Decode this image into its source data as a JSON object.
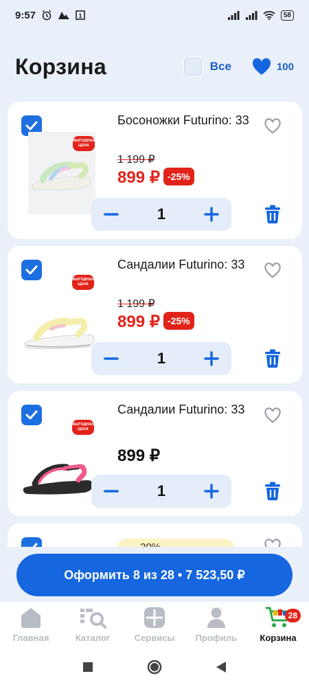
{
  "status_bar": {
    "time": "9:57",
    "battery": "58"
  },
  "header": {
    "title": "Корзина",
    "select_all_label": "Все",
    "favorites_count": "100"
  },
  "cart_items": [
    {
      "title": "Босоножки Futurino: 33",
      "old_price": "1 199 ₽",
      "price": "899 ₽",
      "discount": "-25%",
      "quantity": "1",
      "promo_badge": "ВЫГОДНАЯ ЦЕНА",
      "checked": true
    },
    {
      "title": "Сандалии Futurino: 33",
      "old_price": "1 199 ₽",
      "price": "899 ₽",
      "discount": "-25%",
      "quantity": "1",
      "promo_badge": "ВЫГОДНАЯ ЦЕНА",
      "checked": true
    },
    {
      "title": "Сандалии Futurino: 33",
      "price": "899 ₽",
      "quantity": "1",
      "promo_badge": "ВЫГОДНАЯ ЦЕНА",
      "checked": true
    },
    {
      "label_partial": "-20%"
    }
  ],
  "checkout": {
    "label": "Оформить 8 из 28 • 7 523,50 ₽"
  },
  "tabbar": {
    "items": [
      {
        "label": "Главная",
        "icon": "home-icon"
      },
      {
        "label": "Каталог",
        "icon": "catalog-search-icon"
      },
      {
        "label": "Сервисы",
        "icon": "services-icon"
      },
      {
        "label": "Профиль",
        "icon": "profile-icon"
      },
      {
        "label": "Корзина",
        "icon": "cart-icon"
      }
    ],
    "cart_badge": "28"
  },
  "colors": {
    "accent": "#1566df",
    "sale": "#e2231a",
    "background": "#e9f0fa"
  }
}
